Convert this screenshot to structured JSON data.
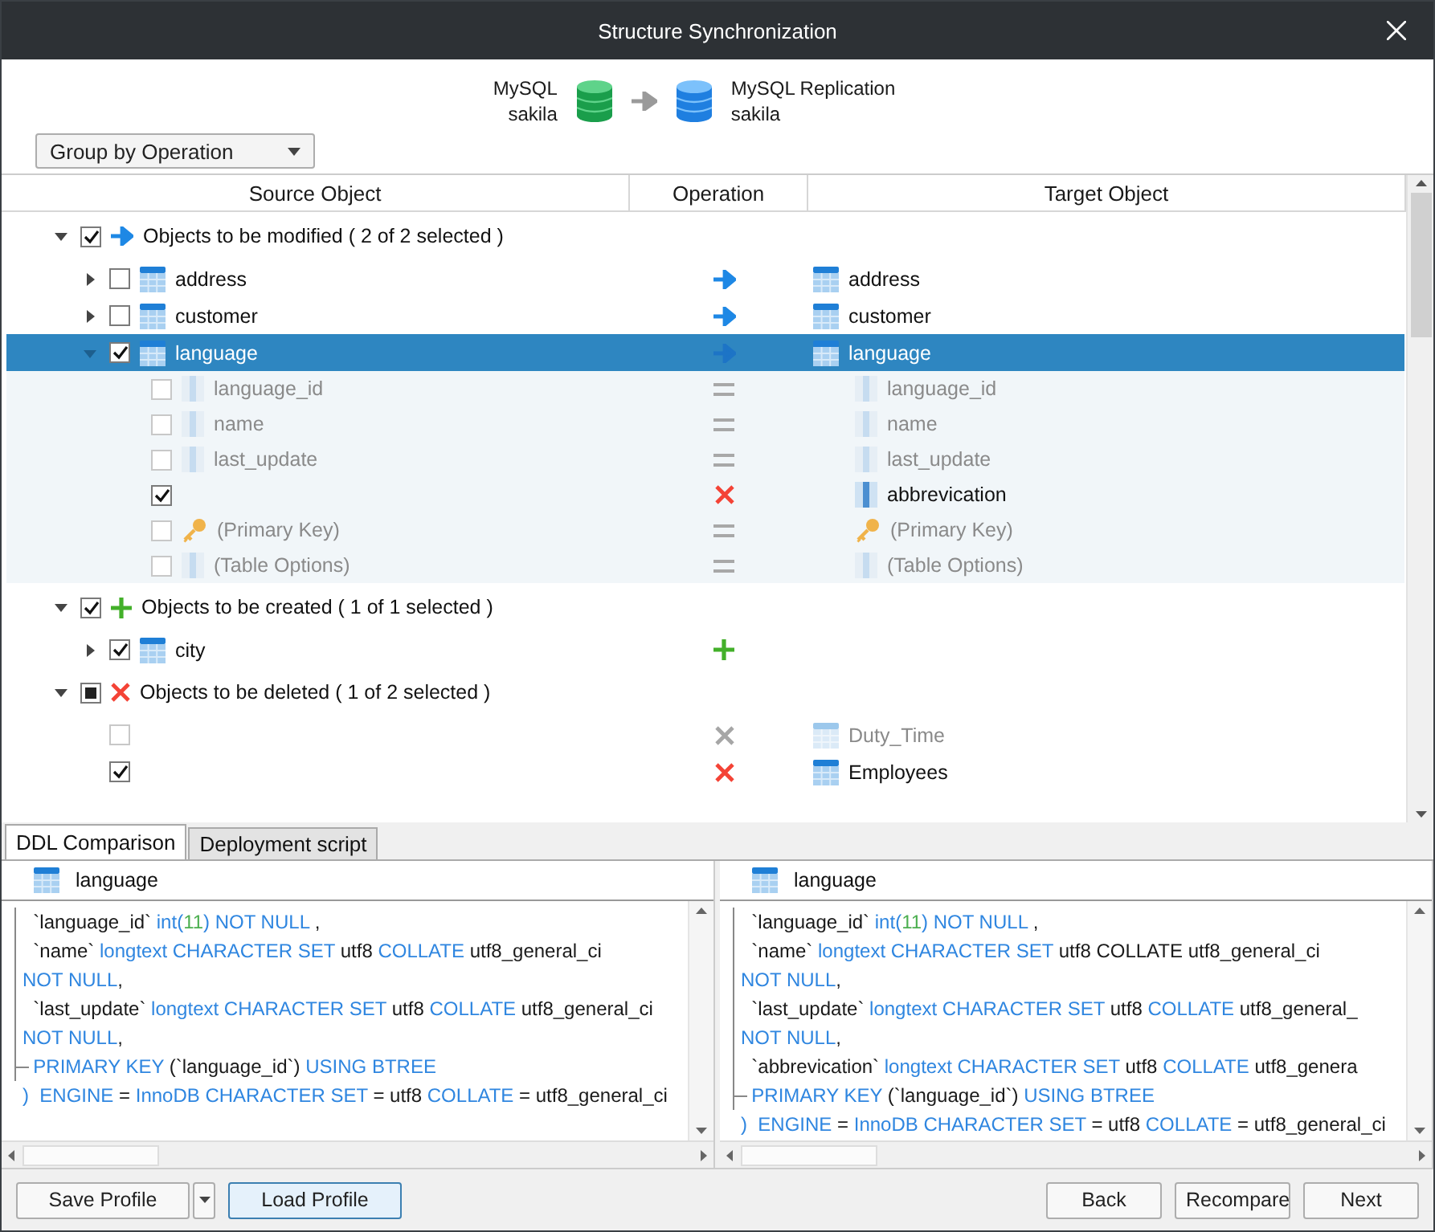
{
  "window": {
    "title": "Structure Synchronization"
  },
  "connection": {
    "source": {
      "server": "MySQL",
      "database": "sakila"
    },
    "target": {
      "server": "MySQL Replication",
      "database": "sakila"
    }
  },
  "group_by": {
    "value": "Group by Operation"
  },
  "tree": {
    "columns": [
      "Source Object",
      "Operation",
      "Target Object"
    ],
    "groups": [
      {
        "label": "Objects to be modified ( 2 of 2 selected )",
        "operation": {
          "kind": "modify"
        },
        "checked": true,
        "expanded": true,
        "items": [
          {
            "kind": "table",
            "source": "address",
            "operation": {
              "kind": "modify"
            },
            "target": "address",
            "checked": false,
            "expanded": false,
            "selected": false,
            "dimmed": false
          },
          {
            "kind": "table",
            "source": "customer",
            "operation": {
              "kind": "modify"
            },
            "target": "customer",
            "checked": false,
            "expanded": false,
            "selected": false,
            "dimmed": false
          },
          {
            "kind": "table",
            "source": "language",
            "operation": {
              "kind": "modify"
            },
            "target": "language",
            "checked": true,
            "expanded": true,
            "selected": true,
            "dimmed": false,
            "children": [
              {
                "kind": "column",
                "source": "language_id",
                "operation": {
                  "kind": "equal"
                },
                "target": "language_id",
                "checked": false,
                "selected": false,
                "dimmed": true
              },
              {
                "kind": "column",
                "source": "name",
                "operation": {
                  "kind": "equal"
                },
                "target": "name",
                "checked": false,
                "selected": false,
                "dimmed": true
              },
              {
                "kind": "column",
                "source": "last_update",
                "operation": {
                  "kind": "equal"
                },
                "target": "last_update",
                "checked": false,
                "selected": false,
                "dimmed": true
              },
              {
                "kind": "column",
                "operation": {
                  "kind": "delete"
                },
                "target": "abbrevication",
                "checked": true,
                "selected": false,
                "dimmed": false
              },
              {
                "kind": "key",
                "source": "(Primary Key)",
                "operation": {
                  "kind": "equal"
                },
                "target": "(Primary Key)",
                "checked": false,
                "selected": false,
                "dimmed": true
              },
              {
                "kind": "column",
                "source": "(Table Options)",
                "operation": {
                  "kind": "equal"
                },
                "target": "(Table Options)",
                "checked": false,
                "selected": false,
                "dimmed": true
              }
            ]
          }
        ]
      },
      {
        "label": "Objects to be created ( 1 of 1 selected )",
        "operation": {
          "kind": "create"
        },
        "checked": true,
        "expanded": true,
        "items": [
          {
            "kind": "table",
            "source": "city",
            "operation": {
              "kind": "create"
            },
            "checked": true,
            "expanded": false,
            "selected": false,
            "dimmed": false
          }
        ]
      },
      {
        "label": "Objects to be deleted ( 1 of 2 selected )",
        "operation": {
          "kind": "delete"
        },
        "checked": false,
        "indeterminate": true,
        "expanded": true,
        "items": [
          {
            "kind": "table",
            "operation": {
              "kind": "delete"
            },
            "target": "Duty_Time",
            "checked": false,
            "selected": false,
            "dimmed": true
          },
          {
            "kind": "table",
            "operation": {
              "kind": "delete"
            },
            "target": "Employees",
            "checked": true,
            "selected": false,
            "dimmed": false
          }
        ]
      }
    ]
  },
  "ddl": {
    "tabs": [
      {
        "label": "DDL Comparison",
        "selected": true
      },
      {
        "label": "Deployment script",
        "selected": false
      }
    ],
    "panes": [
      {
        "title": "language",
        "block_lines": [
          [
            {
              "kind": "plain",
              "t": "  `language_id` "
            },
            {
              "kind": "kw",
              "t": "int("
            },
            {
              "kind": "num",
              "t": "11"
            },
            {
              "kind": "kw",
              "t": ") NOT NULL"
            },
            {
              "kind": "plain",
              "t": " ,"
            }
          ],
          [
            {
              "kind": "plain",
              "t": "  `name` "
            },
            {
              "kind": "kw",
              "t": "longtext CHARACTER SET"
            },
            {
              "kind": "plain",
              "t": " utf8 "
            },
            {
              "kind": "kw",
              "t": "COLLATE"
            },
            {
              "kind": "plain",
              "t": " utf8_general_ci"
            }
          ],
          [
            {
              "kind": "kw",
              "t": "NOT NULL"
            },
            {
              "kind": "plain",
              "t": ","
            }
          ],
          [
            {
              "kind": "plain",
              "t": "  `last_update` "
            },
            {
              "kind": "kw",
              "t": "longtext CHARACTER SET"
            },
            {
              "kind": "plain",
              "t": " utf8 "
            },
            {
              "kind": "kw",
              "t": "COLLATE"
            },
            {
              "kind": "plain",
              "t": " utf8_general_ci"
            }
          ],
          [
            {
              "kind": "kw",
              "t": "NOT NULL"
            },
            {
              "kind": "plain",
              "t": ","
            }
          ],
          [
            {
              "kind": "kw",
              "t": "  PRIMARY KEY"
            },
            {
              "kind": "plain",
              "t": " (`language_id`) "
            },
            {
              "kind": "kw",
              "t": "USING BTREE"
            }
          ]
        ],
        "tail_lines": [
          [
            {
              "kind": "kw",
              "t": ")  ENGINE"
            },
            {
              "kind": "plain",
              "t": " = "
            },
            {
              "kind": "kw",
              "t": "InnoDB CHARACTER SET"
            },
            {
              "kind": "plain",
              "t": " = utf8 "
            },
            {
              "kind": "kw",
              "t": "COLLATE"
            },
            {
              "kind": "plain",
              "t": " = utf8_general_ci"
            }
          ]
        ]
      },
      {
        "title": "language",
        "block_lines": [
          [
            {
              "kind": "plain",
              "t": "  `language_id` "
            },
            {
              "kind": "kw",
              "t": "int("
            },
            {
              "kind": "num",
              "t": "11"
            },
            {
              "kind": "kw",
              "t": ") NOT NULL"
            },
            {
              "kind": "plain",
              "t": " ,"
            }
          ],
          [
            {
              "kind": "plain",
              "t": "  `name` "
            },
            {
              "kind": "kw",
              "t": "longtext CHARACTER SET"
            },
            {
              "kind": "plain",
              "t": " utf8 COLLATE utf8_general_ci"
            }
          ],
          [
            {
              "kind": "kw",
              "t": "NOT NULL"
            },
            {
              "kind": "plain",
              "t": ","
            }
          ],
          [
            {
              "kind": "plain",
              "t": "  `last_update` "
            },
            {
              "kind": "kw",
              "t": "longtext CHARACTER SET"
            },
            {
              "kind": "plain",
              "t": " utf8 "
            },
            {
              "kind": "kw",
              "t": "COLLATE"
            },
            {
              "kind": "plain",
              "t": " utf8_general_"
            }
          ],
          [
            {
              "kind": "kw",
              "t": "NOT NULL"
            },
            {
              "kind": "plain",
              "t": ","
            }
          ],
          [
            {
              "kind": "plain",
              "t": "  `abbrevication` "
            },
            {
              "kind": "kw",
              "t": "longtext CHARACTER SET"
            },
            {
              "kind": "plain",
              "t": " utf8 "
            },
            {
              "kind": "kw",
              "t": "COLLATE"
            },
            {
              "kind": "plain",
              "t": " utf8_genera"
            }
          ],
          [
            {
              "kind": "kw",
              "t": "  PRIMARY KEY"
            },
            {
              "kind": "plain",
              "t": " (`language_id`) "
            },
            {
              "kind": "kw",
              "t": "USING BTREE"
            }
          ]
        ],
        "tail_lines": [
          [
            {
              "kind": "kw",
              "t": ")  ENGINE"
            },
            {
              "kind": "plain",
              "t": " = "
            },
            {
              "kind": "kw",
              "t": "InnoDB CHARACTER SET"
            },
            {
              "kind": "plain",
              "t": " = utf8 "
            },
            {
              "kind": "kw",
              "t": "COLLATE"
            },
            {
              "kind": "plain",
              "t": " = utf8_general_ci"
            }
          ]
        ]
      }
    ]
  },
  "footer": {
    "left_buttons": [
      {
        "label": "Save Profile",
        "kind": "split",
        "focused": false
      },
      {
        "label": "Load Profile",
        "kind": "plain",
        "focused": true
      }
    ],
    "right_buttons": [
      {
        "label": "Back"
      },
      {
        "label": "Recompare"
      },
      {
        "label": "Next"
      }
    ]
  }
}
